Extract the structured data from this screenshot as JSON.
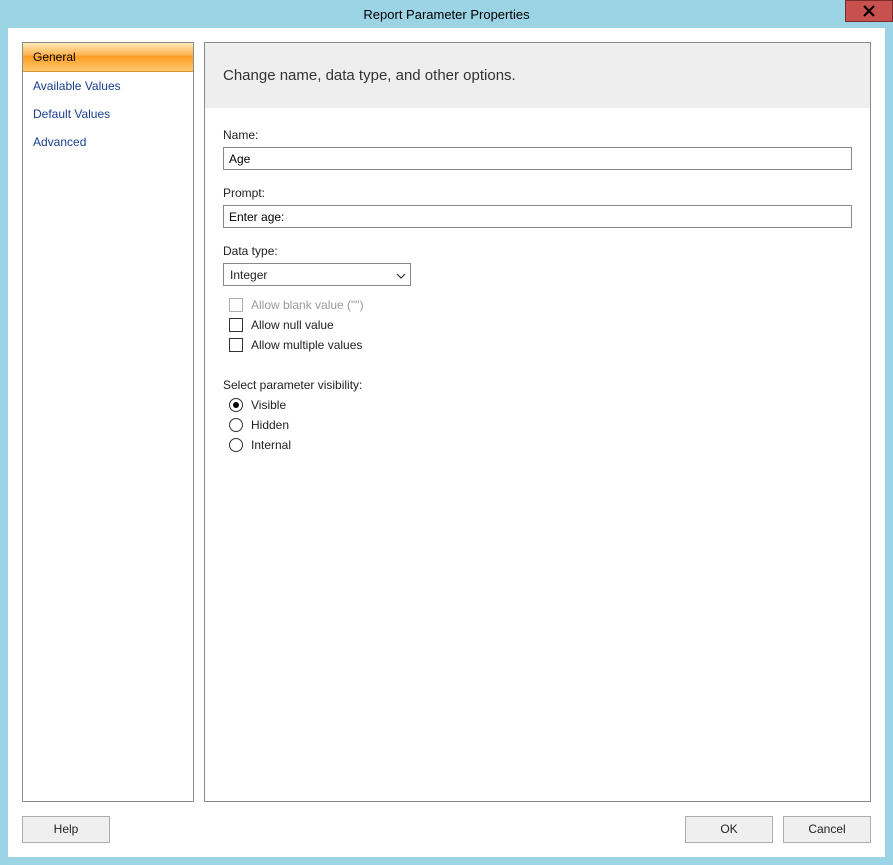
{
  "window": {
    "title": "Report Parameter Properties"
  },
  "sidebar": {
    "items": [
      {
        "label": "General",
        "active": true
      },
      {
        "label": "Available Values",
        "active": false
      },
      {
        "label": "Default Values",
        "active": false
      },
      {
        "label": "Advanced",
        "active": false
      }
    ]
  },
  "header": {
    "text": "Change name, data type, and other options."
  },
  "form": {
    "name_label": "Name:",
    "name_value": "Age",
    "prompt_label": "Prompt:",
    "prompt_value": "Enter age:",
    "datatype_label": "Data type:",
    "datatype_value": "Integer",
    "allow_blank_label": "Allow blank value (\"\")",
    "allow_blank_checked": false,
    "allow_blank_enabled": false,
    "allow_null_label": "Allow null value",
    "allow_null_checked": false,
    "allow_multi_label": "Allow multiple values",
    "allow_multi_checked": false,
    "visibility_label": "Select parameter visibility:",
    "visibility_options": {
      "visible": "Visible",
      "hidden": "Hidden",
      "internal": "Internal"
    },
    "visibility_selected": "visible"
  },
  "buttons": {
    "help": "Help",
    "ok": "OK",
    "cancel": "Cancel"
  }
}
